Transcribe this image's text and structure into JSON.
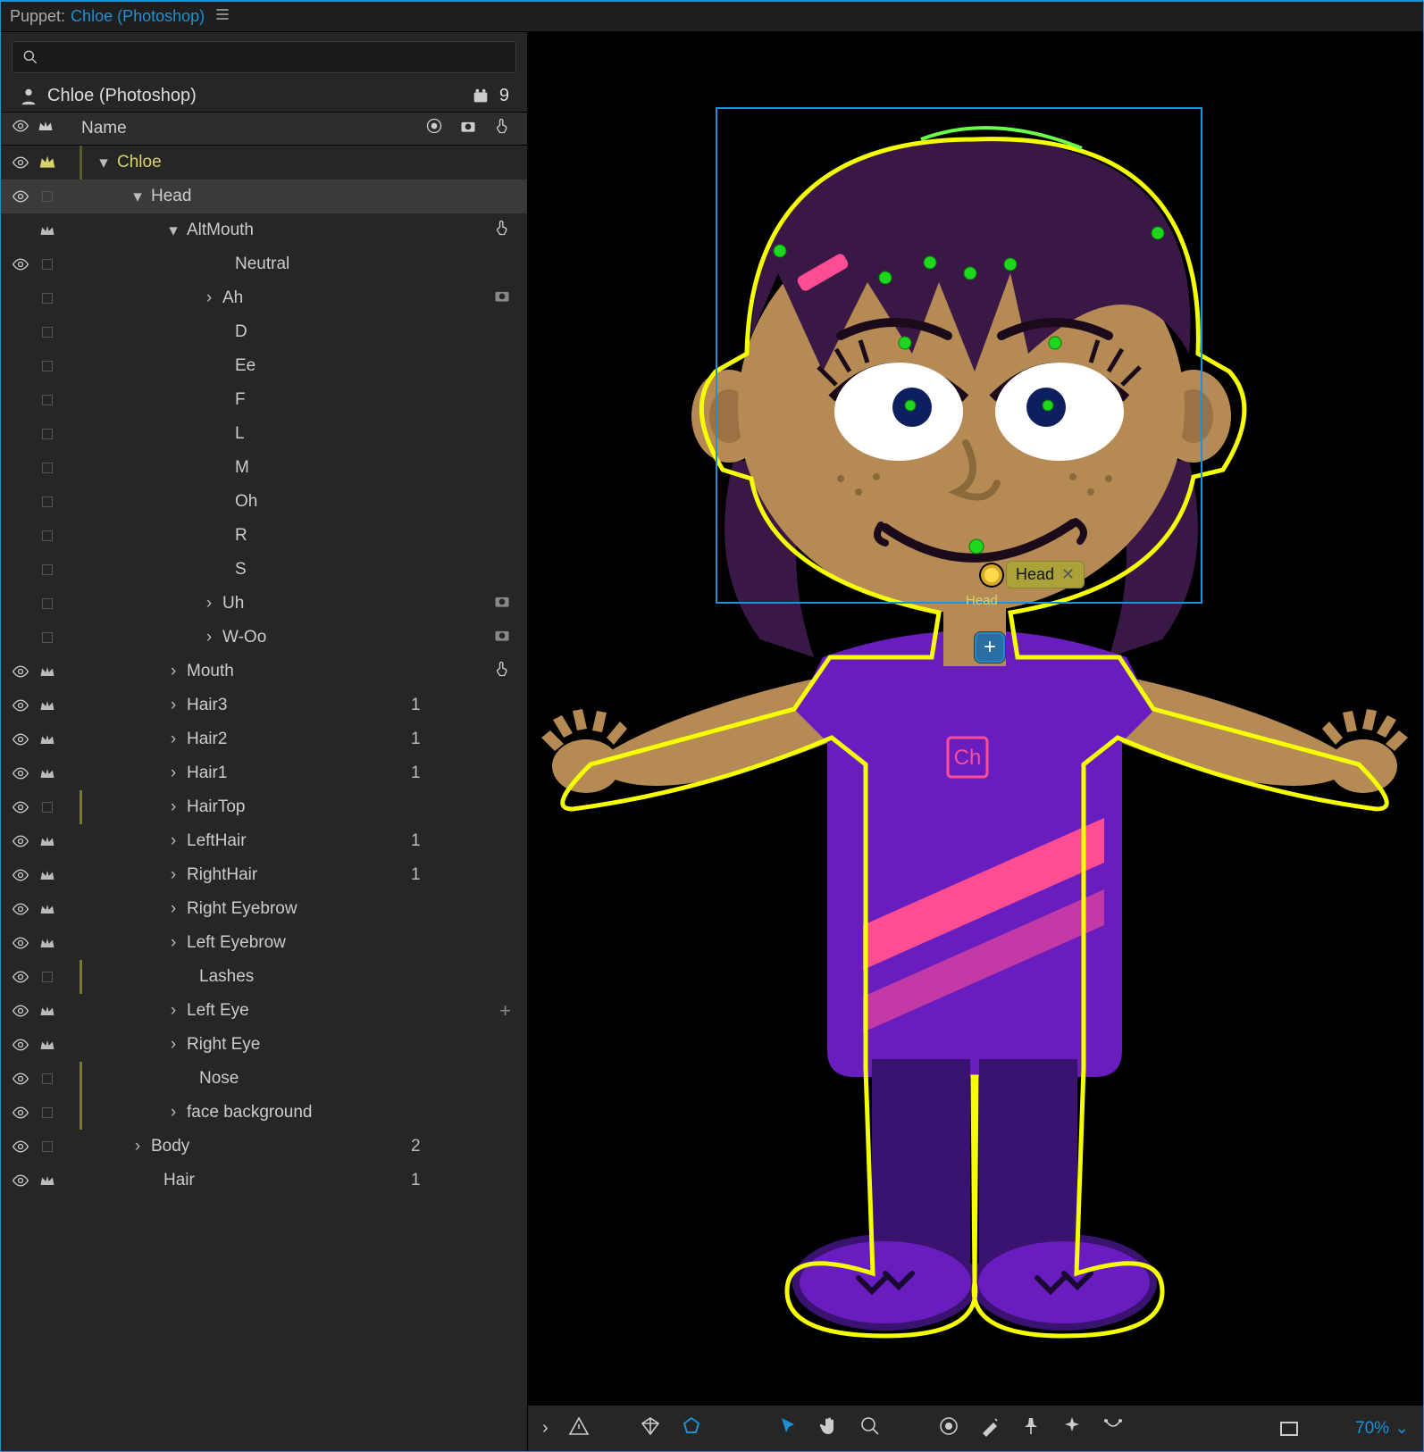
{
  "header": {
    "prefix": "Puppet:",
    "title": "Chloe (Photoshop)"
  },
  "search": {
    "placeholder": ""
  },
  "puppet": {
    "name": "Chloe (Photoshop)",
    "warp_count": "9"
  },
  "columns": {
    "name": "Name"
  },
  "rows": {
    "chloe": "Chloe",
    "head": "Head",
    "altmouth": "AltMouth",
    "neutral": "Neutral",
    "ah": "Ah",
    "d": "D",
    "ee": "Ee",
    "f": "F",
    "l": "L",
    "m": "M",
    "oh": "Oh",
    "r": "R",
    "s": "S",
    "uh": "Uh",
    "woo": "W-Oo",
    "mouth": "Mouth",
    "hair3": "Hair3",
    "hair2": "Hair2",
    "hair1": "Hair1",
    "hairtop": "HairTop",
    "lefthair": "LeftHair",
    "righthair": "RightHair",
    "righteyebrow": "Right Eyebrow",
    "lefteyebrow": "Left Eyebrow",
    "lashes": "Lashes",
    "lefteye": "Left Eye",
    "righteye": "Right Eye",
    "nose": "Nose",
    "facebg": "face background",
    "body": "Body",
    "hair": "Hair"
  },
  "vals": {
    "one": "1",
    "two": "2"
  },
  "canvas": {
    "sel_label": "Head",
    "zoom": "70%",
    "chip": "Ch"
  }
}
